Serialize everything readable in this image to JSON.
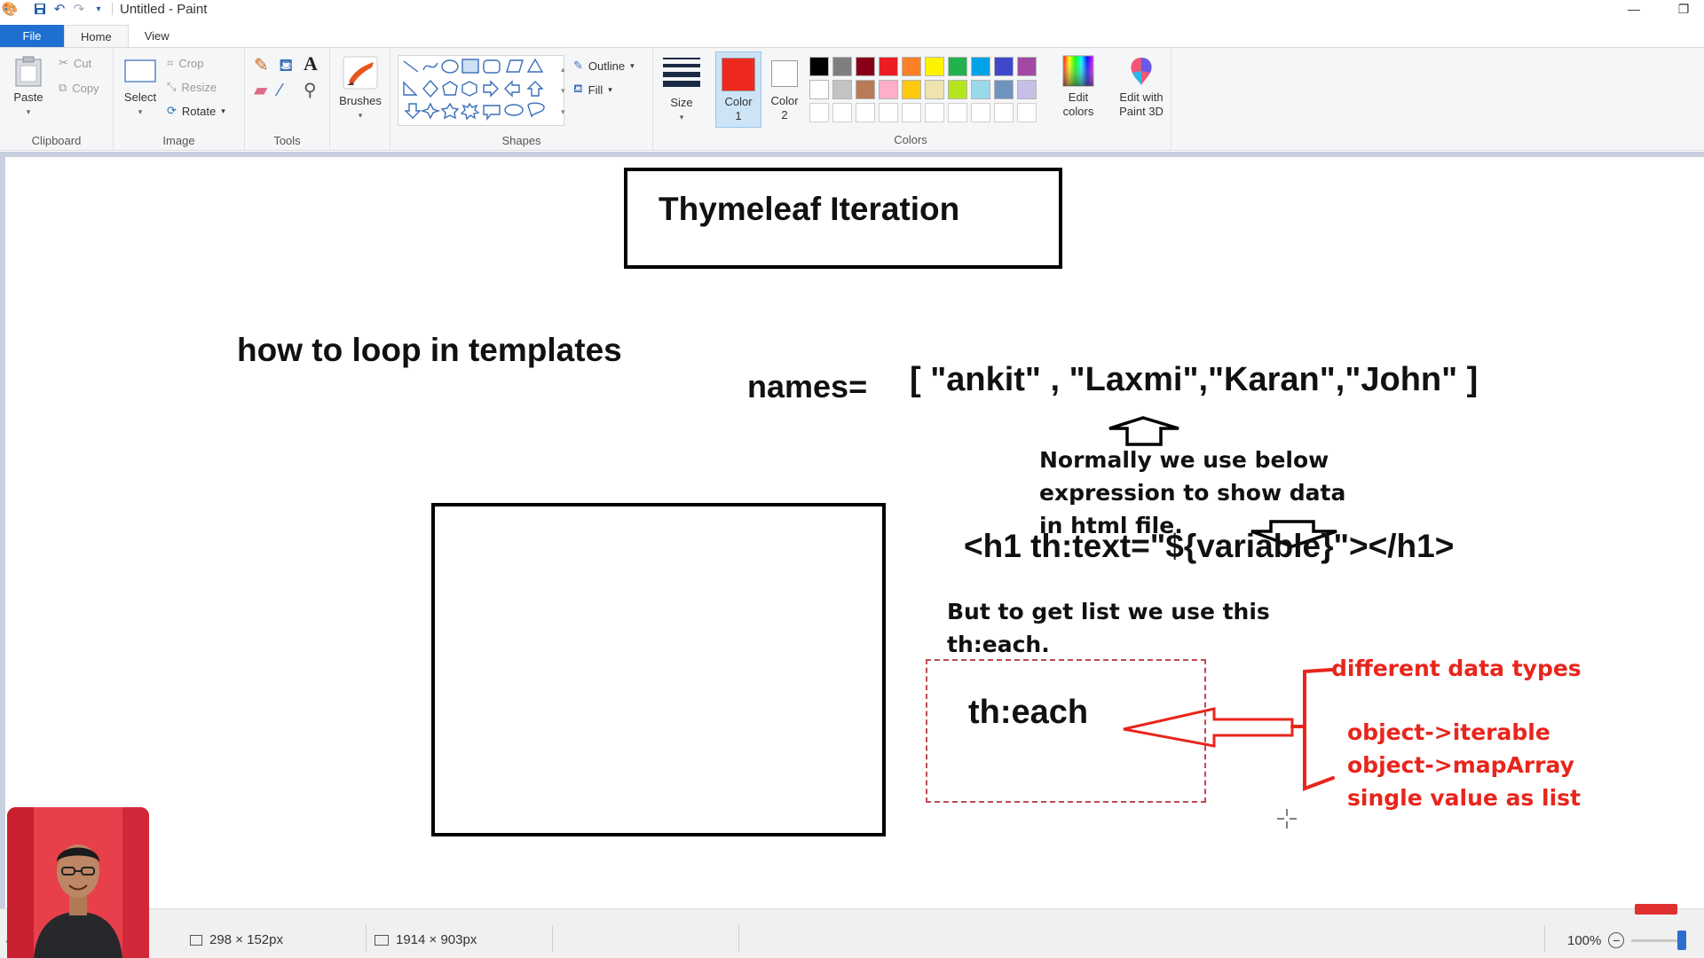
{
  "window": {
    "title": "Untitled - Paint",
    "minimize_glyph": "—",
    "restore_glyph": "❐"
  },
  "tabs": [
    "File",
    "Home",
    "View"
  ],
  "ribbon": {
    "clipboard": {
      "label": "Clipboard",
      "paste": "Paste",
      "cut": "Cut",
      "copy": "Copy"
    },
    "image": {
      "label": "Image",
      "select": "Select",
      "crop": "Crop",
      "resize": "Resize",
      "rotate": "Rotate"
    },
    "tools": {
      "label": "Tools"
    },
    "brushes": {
      "label": "Brushes"
    },
    "shapes": {
      "label": "Shapes",
      "outline": "Outline",
      "fill": "Fill"
    },
    "size": {
      "label": "Size"
    },
    "colors": {
      "label": "Colors",
      "color1": "Color",
      "color1_num": "1",
      "color2": "Color",
      "color2_num": "2",
      "edit_colors_1": "Edit",
      "edit_colors_2": "colors",
      "paint3d_1": "Edit with",
      "paint3d_2": "Paint 3D",
      "active_color": "#ee2a1e",
      "palette_row1": [
        "#000000",
        "#7f7f7f",
        "#880015",
        "#ed1c24",
        "#ff7f27",
        "#fff200",
        "#22b14c",
        "#00a2e8",
        "#3f48cc",
        "#a349a4"
      ],
      "palette_row2": [
        "#ffffff",
        "#c3c3c3",
        "#b97a57",
        "#ffaec9",
        "#ffc90e",
        "#efe4b0",
        "#b5e61d",
        "#99d9ea",
        "#7092be",
        "#c8bfe7"
      ]
    }
  },
  "canvas": {
    "title": "Thymeleaf Iteration",
    "heading": "how to loop in templates",
    "names": "names=",
    "names_list": "[ \"ankit\" , \"Laxmi\",\"Karan\",\"John\" ]",
    "normally_1": "Normally we use below",
    "normally_2": "expression to show data",
    "normally_3": "in html file.",
    "h1_expr": "<h1  th:text=\"${variable}\"></h1>",
    "list_1": "But to get list we use this",
    "list_2": "th:each.",
    "theach": "th:each",
    "diff_types": "different data types",
    "iterable": "object->iterable",
    "maparray": "object->mapArray",
    "single": "single value as list"
  },
  "status": {
    "selection_size": "298 × 152px",
    "canvas_size": "1914 × 903px",
    "zoom": "100%"
  }
}
